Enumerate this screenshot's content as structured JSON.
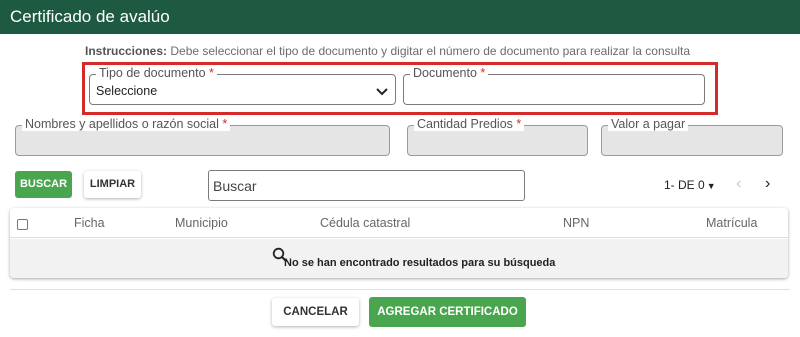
{
  "header": {
    "title": "Certificado de avalúo"
  },
  "instructions": {
    "label": "Instrucciones:",
    "text": " Debe seleccionar el tipo de documento y digitar el número de documento para realizar la consulta"
  },
  "form": {
    "tipo_documento": {
      "label": "Tipo de documento",
      "required": "*",
      "value": "Seleccione"
    },
    "documento": {
      "label": "Documento",
      "required": "*",
      "value": ""
    },
    "nombres": {
      "label": "Nombres y apellidos o razón social",
      "required": "*",
      "value": ""
    },
    "cantidad_predios": {
      "label": "Cantidad Predios",
      "required": "*",
      "value": ""
    },
    "valor_pagar": {
      "label": "Valor a pagar",
      "value": ""
    }
  },
  "toolbar": {
    "buscar_label": "BUSCAR",
    "limpiar_label": "LIMPIAR",
    "search_placeholder": "Buscar",
    "pager_text": "1- DE 0",
    "prev_label": "‹",
    "next_label": "›"
  },
  "table": {
    "columns": [
      "Ficha",
      "Municipio",
      "Cédula catastral",
      "NPN",
      "Matrícula"
    ],
    "empty_message": "No se han encontrado resultados para su búsqueda"
  },
  "footer": {
    "cancel_label": "CANCELAR",
    "add_label": "AGREGAR CERTIFICADO"
  },
  "colors": {
    "header_bg": "#1e5a41",
    "primary_green": "#4aa54f",
    "highlight_red": "#d42a2a"
  }
}
